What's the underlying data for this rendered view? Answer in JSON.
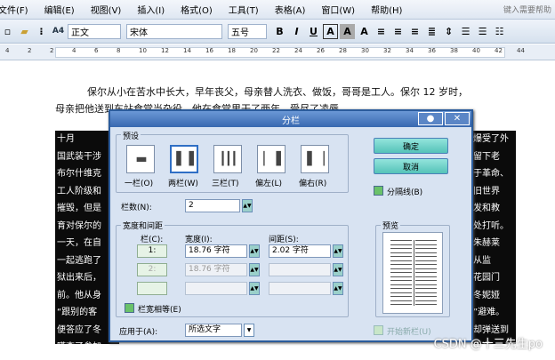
{
  "menu": [
    "文件(F)",
    "编辑(E)",
    "视图(V)",
    "插入(I)",
    "格式(O)",
    "工具(T)",
    "表格(A)",
    "窗口(W)",
    "帮助(H)"
  ],
  "help_placeholder": "键入需要帮助",
  "toolbar": {
    "style": "正文",
    "font": "宋体",
    "size": "五号",
    "style_icon": "A4"
  },
  "ruler_numbers": [
    "4",
    "2",
    "2",
    "4",
    "6",
    "8",
    "10",
    "12",
    "14",
    "16",
    "18",
    "20",
    "22",
    "24",
    "26",
    "28",
    "30",
    "32",
    "34",
    "36",
    "38",
    "40",
    "42",
    "44"
  ],
  "doc": {
    "para1": "保尔从小在苦水中长大，早年丧父，母亲替人洗衣、做饭，哥哥是工人。保尔 12 岁时，",
    "para2": "母亲把他送到车站食堂当杂役，他在食堂里干了两年，受尽了凌辱。",
    "left_col": [
      "十月",
      "国武装干涉",
      "布尔什维克",
      "工人阶级和",
      "摧毁，但是",
      "育对保尔的",
      "一天，在自",
      "一起逃跑了",
      "狱出来后，",
      "前。他从身",
      "“跟别的客",
      "便答应了冬",
      "嗒查了参加"
    ],
    "right_col": [
      "爆受了外",
      "留下老",
      "于革命、",
      "旧世界",
      "发和教",
      "处打听。",
      "朱赫莱",
      "从监",
      "花园门",
      "冬妮娅",
      "”避难。",
      "却弹送到",
      "大道,"
    ]
  },
  "dialog": {
    "title": "分栏",
    "presets_label": "预设",
    "presets": [
      "一栏(O)",
      "两栏(W)",
      "三栏(T)",
      "偏左(L)",
      "偏右(R)"
    ],
    "ok": "确定",
    "cancel": "取消",
    "divider_label": "分隔线(B)",
    "num_cols_label": "栏数(N):",
    "num_cols_value": "2",
    "width_spacing_label": "宽度和间距",
    "col_header": "栏(C):",
    "width_header": "宽度(I):",
    "spacing_header": "间距(S):",
    "rows": [
      {
        "col": "1:",
        "width": "18.76 字符",
        "spacing": "2.02 字符"
      },
      {
        "col": "2:",
        "width": "18.76 字符",
        "spacing": ""
      },
      {
        "col": "",
        "width": "",
        "spacing": ""
      }
    ],
    "equal_width_label": "栏宽相等(E)",
    "apply_to_label": "应用于(A):",
    "apply_to_value": "所选文字",
    "preview_label": "预览",
    "new_col_label": "开始新栏(U)"
  },
  "watermark": "CSDN @十三先生po",
  "colors": {
    "accent": "#3868b0",
    "button": "#55c3b8",
    "dialog_bg": "#d8e3f2"
  }
}
